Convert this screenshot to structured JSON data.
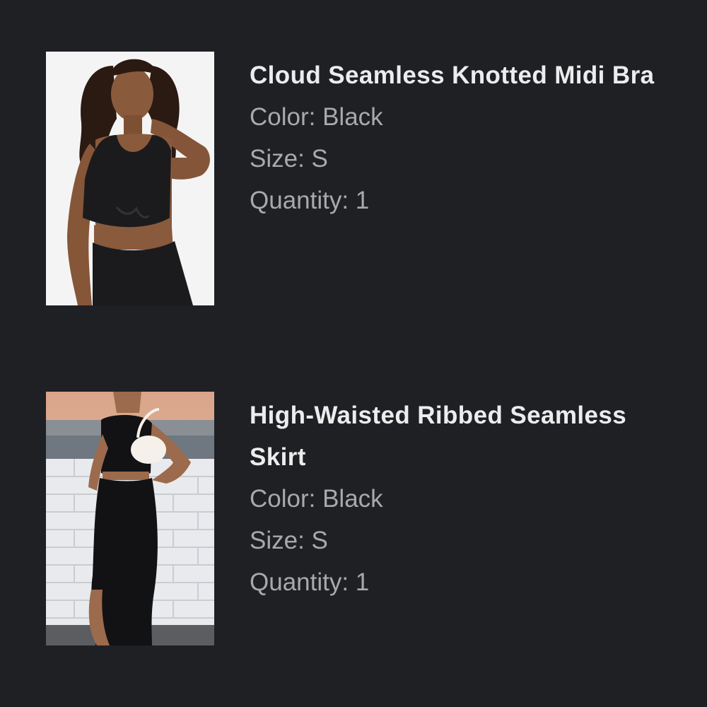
{
  "order_items": [
    {
      "title": "Cloud Seamless Knotted Midi Bra",
      "color_text": "Color: Black",
      "size_text": "Size: S",
      "quantity_text": "Quantity: 1",
      "image_icon": "product-photo-top"
    },
    {
      "title": "High-Waisted Ribbed Seamless Skirt",
      "color_text": "Color: Black",
      "size_text": "Size: S",
      "quantity_text": "Quantity: 1",
      "image_icon": "product-photo-skirt"
    }
  ],
  "colors": {
    "background": "#1f2024",
    "title": "#ececed",
    "meta": "#a9a9ad"
  }
}
